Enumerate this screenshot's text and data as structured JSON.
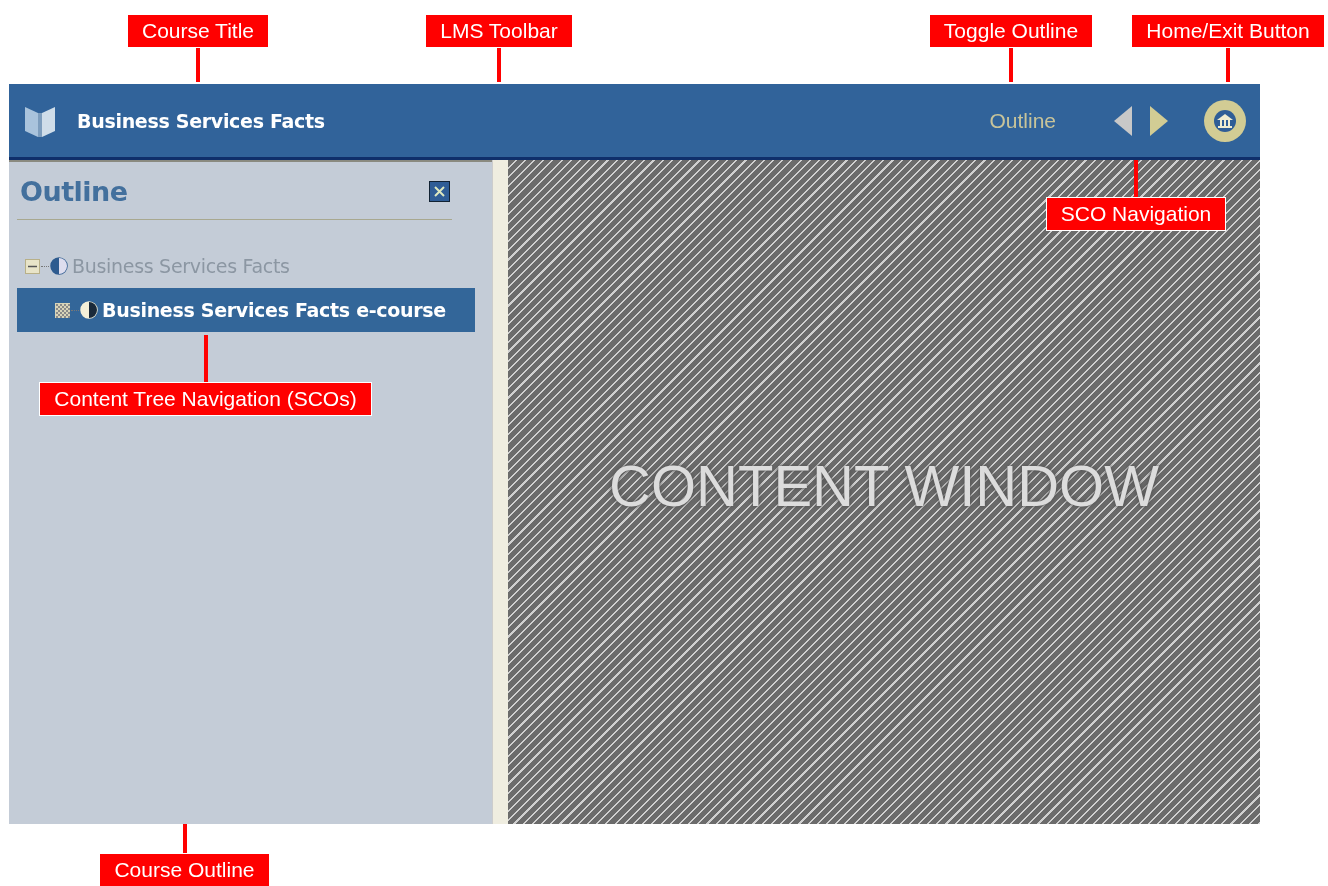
{
  "toolbar": {
    "course_title": "Business Services Facts",
    "toggle_outline": "Outline",
    "prev_enabled": false,
    "next_enabled": true
  },
  "outline": {
    "title": "Outline",
    "tree": [
      {
        "label": "Business Services Facts",
        "expanded": true,
        "selected": false,
        "children": [
          {
            "label": "Business Services Facts e-course",
            "selected": true
          }
        ]
      }
    ]
  },
  "content": {
    "watermark": "CONTENT WINDOW"
  },
  "callouts": [
    {
      "label": "Course Title"
    },
    {
      "label": "LMS Toolbar"
    },
    {
      "label": "Toggle Outline"
    },
    {
      "label": "Home/Exit Button"
    },
    {
      "label": "SCO Navigation"
    },
    {
      "label": "Content Tree Navigation (SCOs)"
    },
    {
      "label": "Course Outline"
    }
  ]
}
